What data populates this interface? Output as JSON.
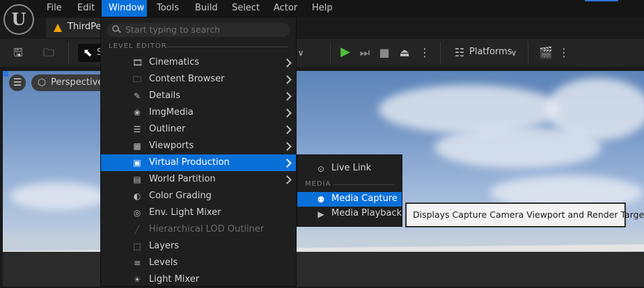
{
  "menubar": {
    "items": [
      {
        "label": "File"
      },
      {
        "label": "Edit"
      },
      {
        "label": "Window",
        "active": true
      },
      {
        "label": "Tools"
      },
      {
        "label": "Build"
      },
      {
        "label": "Select"
      },
      {
        "label": "Actor"
      },
      {
        "label": "Help"
      }
    ]
  },
  "logo": {
    "letter": "U"
  },
  "tab": {
    "label": "ThirdPe"
  },
  "toolbar": {
    "mode_label": "S",
    "platforms_label": "Platforms",
    "play_color": "#4fbf3a"
  },
  "viewport": {
    "perspective_label": "Perspective"
  },
  "window_menu": {
    "search_placeholder": "Start typing to search",
    "section": "LEVEL EDITOR",
    "items": [
      {
        "label": "Cinematics",
        "icon": "film-icon",
        "submenu": true
      },
      {
        "label": "Content Browser",
        "icon": "folder-search-icon",
        "submenu": true
      },
      {
        "label": "Details",
        "icon": "pencil-icon",
        "submenu": true
      },
      {
        "label": "ImgMedia",
        "icon": "film-reel-icon",
        "submenu": true
      },
      {
        "label": "Outliner",
        "icon": "list-icon",
        "submenu": true
      },
      {
        "label": "Viewports",
        "icon": "grid-icon",
        "submenu": true
      },
      {
        "label": "Virtual Production",
        "icon": "person-frame-icon",
        "submenu": true,
        "highlighted": true
      },
      {
        "label": "World Partition",
        "icon": "partition-icon",
        "submenu": true
      },
      {
        "label": "Color Grading",
        "icon": "color-wheel-icon",
        "submenu": false
      },
      {
        "label": "Env. Light Mixer",
        "icon": "light-mixer-icon",
        "submenu": false
      },
      {
        "label": "Hierarchical LOD Outliner",
        "icon": "hlod-icon",
        "submenu": false,
        "disabled": true
      },
      {
        "label": "Layers",
        "icon": "layers-icon",
        "submenu": false
      },
      {
        "label": "Levels",
        "icon": "levels-icon",
        "submenu": false
      },
      {
        "label": "Light Mixer",
        "icon": "light-mixer-icon",
        "submenu": false
      }
    ]
  },
  "sub_menu": {
    "items": [
      {
        "label": "Live Link",
        "icon": "live-link-icon"
      },
      {
        "label": "Media Capture",
        "icon": "media-capture-icon",
        "highlighted": true
      },
      {
        "label": "Media Playback",
        "icon": "media-playback-icon"
      }
    ],
    "section": "MEDIA"
  },
  "tooltip": {
    "text": "Displays Capture Camera Viewport and Render Target."
  }
}
